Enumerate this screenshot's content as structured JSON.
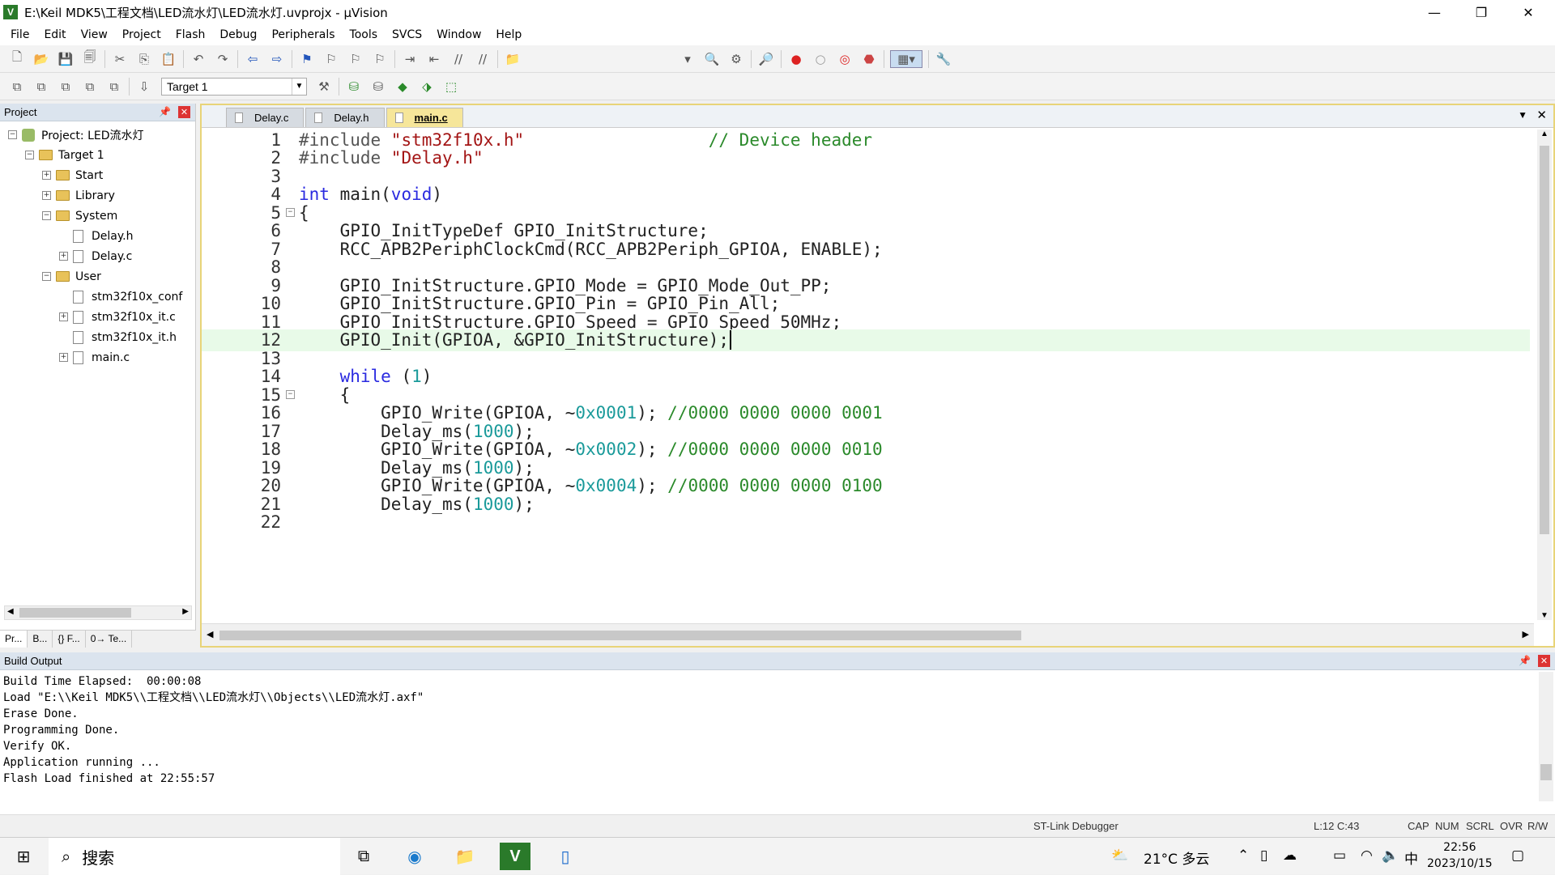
{
  "window": {
    "title": "E:\\Keil MDK5\\工程文档\\LED流水灯\\LED流水灯.uvprojx - µVision",
    "minimize": "—",
    "restore": "❐",
    "close": "✕"
  },
  "menu": [
    "File",
    "Edit",
    "View",
    "Project",
    "Flash",
    "Debug",
    "Peripherals",
    "Tools",
    "SVCS",
    "Window",
    "Help"
  ],
  "toolbar2": {
    "target": "Target 1"
  },
  "project_panel": {
    "title": "Project",
    "tree": [
      {
        "label": "Project: LED流水灯",
        "depth": 0,
        "type": "project",
        "exp": "−"
      },
      {
        "label": "Target 1",
        "depth": 1,
        "type": "target",
        "exp": "−"
      },
      {
        "label": "Start",
        "depth": 2,
        "type": "folder",
        "exp": "+"
      },
      {
        "label": "Library",
        "depth": 2,
        "type": "folder",
        "exp": "+"
      },
      {
        "label": "System",
        "depth": 2,
        "type": "folder",
        "exp": "−"
      },
      {
        "label": "Delay.h",
        "depth": 3,
        "type": "file",
        "exp": ""
      },
      {
        "label": "Delay.c",
        "depth": 3,
        "type": "file",
        "exp": "+"
      },
      {
        "label": "User",
        "depth": 2,
        "type": "folder",
        "exp": "−"
      },
      {
        "label": "stm32f10x_conf",
        "depth": 3,
        "type": "file",
        "exp": ""
      },
      {
        "label": "stm32f10x_it.c",
        "depth": 3,
        "type": "file",
        "exp": "+"
      },
      {
        "label": "stm32f10x_it.h",
        "depth": 3,
        "type": "file",
        "exp": ""
      },
      {
        "label": "main.c",
        "depth": 3,
        "type": "file",
        "exp": "+"
      }
    ],
    "tabs": [
      "Pr...",
      "B...",
      "{} F...",
      "0→ Te..."
    ]
  },
  "editor": {
    "tabs": [
      {
        "label": "Delay.c",
        "active": false
      },
      {
        "label": "Delay.h",
        "active": false
      },
      {
        "label": "main.c",
        "active": true
      }
    ],
    "current_line": 12,
    "lines": [
      [
        [
          "pp",
          "#include "
        ],
        [
          "str",
          "\"stm32f10x.h\""
        ],
        [
          "",
          "                  "
        ],
        [
          "cmt",
          "// Device header"
        ]
      ],
      [
        [
          "pp",
          "#include "
        ],
        [
          "str",
          "\"Delay.h\""
        ]
      ],
      [],
      [
        [
          "kw",
          "int"
        ],
        [
          "",
          " main("
        ],
        [
          "kw",
          "void"
        ],
        [
          "",
          ")"
        ]
      ],
      [
        [
          "",
          "{"
        ]
      ],
      [
        [
          "",
          "    GPIO_InitTypeDef GPIO_InitStructure;"
        ]
      ],
      [
        [
          "",
          "    RCC_APB2PeriphClockCmd(RCC_APB2Periph_GPIOA, ENABLE);"
        ]
      ],
      [],
      [
        [
          "",
          "    GPIO_InitStructure.GPIO_Mode = GPIO_Mode_Out_PP;"
        ]
      ],
      [
        [
          "",
          "    GPIO_InitStructure.GPIO_Pin = GPIO_Pin_All;"
        ]
      ],
      [
        [
          "",
          "    GPIO_InitStructure.GPIO_Speed = GPIO_Speed_50MHz;"
        ]
      ],
      [
        [
          "",
          "    GPIO_Init(GPIOA, &GPIO_InitStructure);"
        ]
      ],
      [],
      [
        [
          "",
          "    "
        ],
        [
          "kw",
          "while"
        ],
        [
          "",
          " ("
        ],
        [
          "num",
          "1"
        ],
        [
          "",
          ")"
        ]
      ],
      [
        [
          "",
          "    {"
        ]
      ],
      [
        [
          "",
          "        GPIO_Write(GPIOA, ~"
        ],
        [
          "num",
          "0x0001"
        ],
        [
          "",
          "); "
        ],
        [
          "cmt",
          "//0000 0000 0000 0001"
        ]
      ],
      [
        [
          "",
          "        Delay_ms("
        ],
        [
          "num",
          "1000"
        ],
        [
          "",
          ");"
        ]
      ],
      [
        [
          "",
          "        GPIO_Write(GPIOA, ~"
        ],
        [
          "num",
          "0x0002"
        ],
        [
          "",
          "); "
        ],
        [
          "cmt",
          "//0000 0000 0000 0010"
        ]
      ],
      [
        [
          "",
          "        Delay_ms("
        ],
        [
          "num",
          "1000"
        ],
        [
          "",
          ");"
        ]
      ],
      [
        [
          "",
          "        GPIO_Write(GPIOA, ~"
        ],
        [
          "num",
          "0x0004"
        ],
        [
          "",
          "); "
        ],
        [
          "cmt",
          "//0000 0000 0000 0100"
        ]
      ],
      [
        [
          "",
          "        Delay_ms("
        ],
        [
          "num",
          "1000"
        ],
        [
          "",
          ");"
        ]
      ],
      []
    ],
    "fold_lines": [
      5,
      15
    ]
  },
  "build_output": {
    "title": "Build Output",
    "text": "Build Time Elapsed:  00:00:08\nLoad \"E:\\\\Keil MDK5\\\\工程文档\\\\LED流水灯\\\\Objects\\\\LED流水灯.axf\"\nErase Done.\nProgramming Done.\nVerify OK.\nApplication running ...\nFlash Load finished at 22:55:57"
  },
  "status": {
    "debugger": "ST-Link Debugger",
    "position": "L:12 C:43",
    "flags": [
      "CAP",
      "NUM",
      "SCRL",
      "OVR",
      "R/W"
    ]
  },
  "taskbar": {
    "search": "搜索",
    "weather": "21°C 多云",
    "ime": "中",
    "time": "22:56",
    "date": "2023/10/15"
  }
}
